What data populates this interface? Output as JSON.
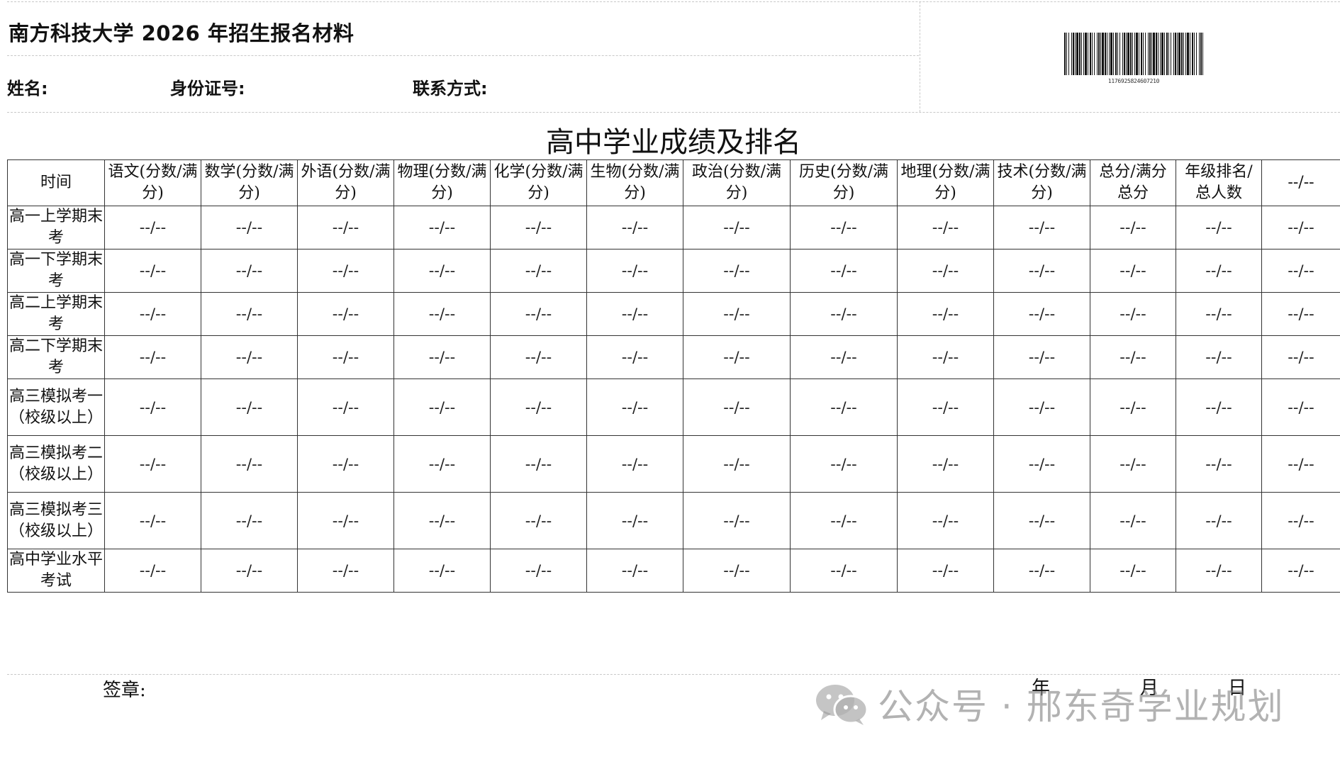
{
  "document": {
    "title": "南方科技大学 2026 年招生报名材料",
    "fields": {
      "name_label": "姓名:",
      "id_label": "身份证号:",
      "contact_label": "联系方式:"
    },
    "barcode": {
      "number": "1176925824607210"
    },
    "table_heading": "高中学业成绩及排名",
    "table": {
      "headers": [
        "时间",
        "语文(分数/满分)",
        "数学(分数/满分)",
        "外语(分数/满分)",
        "物理(分数/满分)",
        "化学(分数/满分)",
        "生物(分数/满分)",
        "政治(分数/满分)",
        "历史(分数/满分)",
        "地理(分数/满分)",
        "技术(分数/满分)",
        "总分/满分总分",
        "年级排名/总人数",
        "--/--"
      ],
      "rows": [
        {
          "label": "高一上学期末考",
          "cells": [
            "--/--",
            "--/--",
            "--/--",
            "--/--",
            "--/--",
            "--/--",
            "--/--",
            "--/--",
            "--/--",
            "--/--",
            "--/--",
            "--/--",
            "--/--"
          ]
        },
        {
          "label": "高一下学期末考",
          "cells": [
            "--/--",
            "--/--",
            "--/--",
            "--/--",
            "--/--",
            "--/--",
            "--/--",
            "--/--",
            "--/--",
            "--/--",
            "--/--",
            "--/--",
            "--/--"
          ]
        },
        {
          "label": "高二上学期末考",
          "cells": [
            "--/--",
            "--/--",
            "--/--",
            "--/--",
            "--/--",
            "--/--",
            "--/--",
            "--/--",
            "--/--",
            "--/--",
            "--/--",
            "--/--",
            "--/--"
          ]
        },
        {
          "label": "高二下学期末考",
          "cells": [
            "--/--",
            "--/--",
            "--/--",
            "--/--",
            "--/--",
            "--/--",
            "--/--",
            "--/--",
            "--/--",
            "--/--",
            "--/--",
            "--/--",
            "--/--"
          ]
        },
        {
          "label": "高三模拟考一（校级以上）",
          "cells": [
            "--/--",
            "--/--",
            "--/--",
            "--/--",
            "--/--",
            "--/--",
            "--/--",
            "--/--",
            "--/--",
            "--/--",
            "--/--",
            "--/--",
            "--/--"
          ]
        },
        {
          "label": "高三模拟考二（校级以上）",
          "cells": [
            "--/--",
            "--/--",
            "--/--",
            "--/--",
            "--/--",
            "--/--",
            "--/--",
            "--/--",
            "--/--",
            "--/--",
            "--/--",
            "--/--",
            "--/--"
          ]
        },
        {
          "label": "高三模拟考三（校级以上）",
          "cells": [
            "--/--",
            "--/--",
            "--/--",
            "--/--",
            "--/--",
            "--/--",
            "--/--",
            "--/--",
            "--/--",
            "--/--",
            "--/--",
            "--/--",
            "--/--"
          ]
        },
        {
          "label": "高中学业水平考试",
          "cells": [
            "--/--",
            "--/--",
            "--/--",
            "--/--",
            "--/--",
            "--/--",
            "--/--",
            "--/--",
            "--/--",
            "--/--",
            "--/--",
            "--/--",
            "--/--"
          ]
        }
      ]
    },
    "signature": {
      "label": "签章:",
      "year": "年",
      "month": "月",
      "day": "日"
    },
    "watermark": {
      "text": "公众号 · 邢东奇学业规划",
      "icon": "wechat-icon"
    }
  }
}
